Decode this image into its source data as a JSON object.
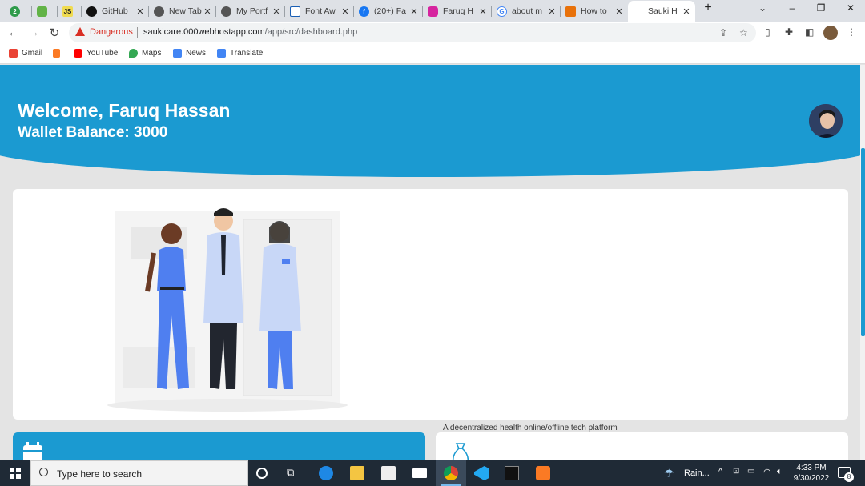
{
  "tabs": [
    {
      "label": "",
      "close": ""
    },
    {
      "label": "",
      "close": ""
    },
    {
      "label": "",
      "close": ""
    },
    {
      "label": "GitHub",
      "close": "✕"
    },
    {
      "label": "New Tab",
      "close": "✕"
    },
    {
      "label": "My Portf",
      "close": "✕"
    },
    {
      "label": "Font Aw",
      "close": "✕"
    },
    {
      "label": "(20+) Fa",
      "close": "✕"
    },
    {
      "label": "Faruq H",
      "close": "✕"
    },
    {
      "label": "about m",
      "close": "✕"
    },
    {
      "label": "How to",
      "close": "✕"
    },
    {
      "label": "Sauki H",
      "close": "✕"
    }
  ],
  "toolbar": {
    "security_label": "Dangerous",
    "url_host": "saukicare.000webhostapp.com",
    "url_path": "/app/src/dashboard.php"
  },
  "bookmarks": [
    "Gmail",
    "YouTube",
    "Maps",
    "News",
    "Translate"
  ],
  "dashboard": {
    "welcome": "Welcome, Faruq Hassan",
    "wallet": "Wallet Balance: 3000",
    "tagline": "A decentralized health online/offline tech platform"
  },
  "taskbar": {
    "search_placeholder": "Type here to search",
    "weather": "Rain...",
    "time": "4:33 PM",
    "date": "9/30/2022",
    "notifications": "8"
  },
  "colors": {
    "brand": "#1b9ad1",
    "danger": "#d93025"
  }
}
